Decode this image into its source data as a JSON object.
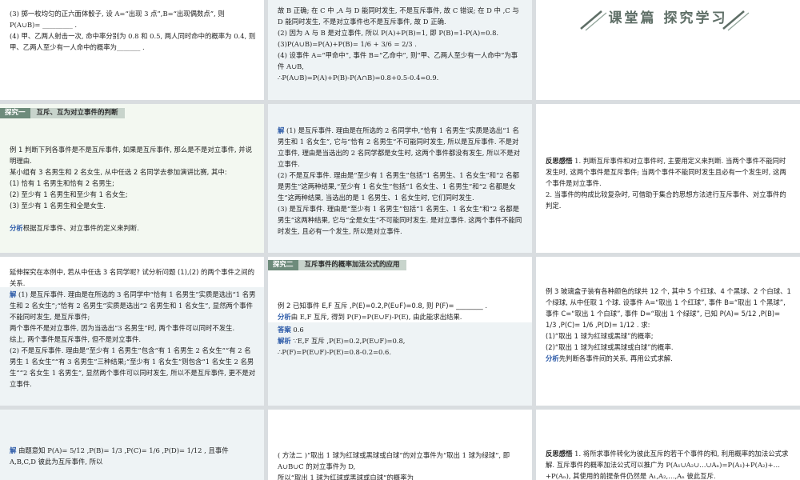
{
  "tiles": {
    "t1": {
      "text": "(3) 掷一枚均匀的正六面体骰子, 设 A=“出现 3 点”,B=“出现偶数点”, 则 P(A∪B)= _________ .\n(4) 甲、乙两人射击一次, 命中率分别为 0.8 和 0.5, 两人同时命中的概率为 0.4, 则甲、乙两人至少有一人命中的概率为_______ ."
    },
    "t2": {
      "text": "故 B 正确; 在 C 中 ,A 与 D 能同时发生, 不是互斥事件, 故 C 错误; 在 D 中 ,C 与 D 能同时发生, 不是对立事件也不是互斥事件, 故 D 正确.\n(2) 因为 A 与 B 是对立事件, 所以 P(A)+P(B)=1, 即 P(B)=1-P(A)=0.8.\n(3)P(A∪B)=P(A)+P(B)= 1/6 + 3/6 = 2/3 .\n(4) 设事件 A=“甲命中”, 事件 B=“乙命中”, 则“甲、乙两人至少有一人命中”为事件 A∪B,\n∴P(A∪B)=P(A)+P(B)-P(A∩B)=0.8+0.5-0.4=0.9."
    },
    "t3": {
      "banner": "课堂篇 探究学习"
    },
    "t4": {
      "tab_num": "探究一",
      "tab_title": "互斥、互为对立事件的判断",
      "example": "例 1 判断下列各事件是不是互斥事件, 如果是互斥事件, 那么是不是对立事件, 并说明理由.\n某小组有 3 名男生和 2 名女生, 从中任选 2 名同学去参加演讲比赛, 其中:\n(1) 恰有 1 名男生和恰有 2 名男生;\n(2) 至少有 1 名男生和至少有 1 名女生;\n(3) 至少有 1 名男生和全是女生.",
      "analysis_label": "分析",
      "analysis": "根据互斥事件、对立事件的定义来判断."
    },
    "t5": {
      "label": "解",
      "text": " (1) 是互斥事件. 理由是在所选的 2 名同学中,“恰有 1 名男生”实质是选出“1 名男生和 1 名女生”, 它与“恰有 2 名男生”不可能同时发生, 所以是互斥事件. 不是对立事件, 理由是当选出的 2 名同学都是女生时, 这两个事件都没有发生, 所以不是对立事件.\n(2) 不是互斥事件. 理由是“至少有 1 名男生”包括“1 名男生、1 名女生”和“2 名都是男生”这两种结果,“至少有 1 名女生”包括“1 名女生、1 名男生”和“2 名都是女生”这两种结果, 当选出的是 1 名男生、1 名女生时, 它们同时发生.\n(3) 是互斥事件. 理由是“至少有 1 名男生”包括“1 名男生、1 名女生”和“2 名都是男生”这两种结果, 它与“全是女生”不可能同时发生. 是对立事件. 这两个事件不能同时发生, 且必有一个发生, 所以是对立事件."
    },
    "t6": {
      "label": "反思感悟",
      "text": " 1. 判断互斥事件和对立事件时, 主要用定义来判断. 当两个事件不能同时发生时, 这两个事件是互斥事件; 当两个事件不能同时发生且必有一个发生时, 这两个事件是对立事件.\n2. 当事件的构成比较复杂时, 可借助于集合的思想方法进行互斥事件、对立事件的判定."
    },
    "t7": {
      "question": "延伸探究在本例中, 若从中任选 3 名同学呢? 试分析问题 (1),(2) 的两个事件之间的关系.",
      "label": "解",
      "text": " (1) 是互斥事件. 理由是在所选的 3 名同学中“恰有 1 名男生”实质是选出“1 名男生和 2 名女生”;“恰有 2 名男生”实质是选出“2 名男生和 1 名女生”, 显然两个事件不能同时发生, 是互斥事件;\n两个事件不是对立事件, 因为当选出“3 名男生”时, 两个事件可以同时不发生.\n综上, 两个事件是互斥事件, 但不是对立事件.\n(2) 不是互斥事件. 理由是“至少有 1 名男生”包含“有 1 名男生 2 名女生”“有 2 名男生 1 名女生”“有 3 名男生”三种结果;“至少有 1 名女生”则包含“1 名女生 2 名男生”“2 名女生 1 名男生”, 显然两个事件可以同时发生, 所以不是互斥事件, 更不是对立事件."
    },
    "t8": {
      "tab_num": "探究二",
      "tab_title": "互斥事件的概率加法公式的应用",
      "example": "例 2 已知事件 E,F 互斥 ,P(E)=0.2,P(E∪F)=0.8, 则 P(F)= ________ .",
      "analysis_label": "分析",
      "analysis": "由 E,F 互斥, 得到 P(F)=P(E∪F)-P(E), 由此能求出结果.",
      "answer_label": "答案",
      "answer": " 0.6",
      "solution_label": "解析",
      "solution": " ∵E,F 互斥 ,P(E)=0.2,P(E∪F)=0.8,\n∴P(F)=P(E∪F)-P(E)=0.8-0.2=0.6."
    },
    "t9": {
      "example": "例 3 玻璃盒子装有各种颜色的球共 12 个, 其中 5 个红球、4 个黑球、2 个白球、1 个绿球, 从中任取 1 个球. 设事件 A=“取出 1 个红球”, 事件 B=“取出 1 个黑球”, 事件 C=“取出 1 个白球”, 事件 D=“取出 1 个绿球”, 已知 P(A)= 5/12 ,P(B)= 1/3 ,P(C)= 1/6 ,P(D)= 1/12 . 求:",
      "q1": "(1)“取出 1 球为红球或黑球”的概率;",
      "q2": "(2)“取出 1 球为红球或黑球或白球”的概率.",
      "analysis_label": "分析",
      "analysis": "先判断各事件间的关系, 再用公式求解."
    },
    "t10": {
      "label": "解",
      "text": " 由题意知 P(A)= 5/12 ,P(B)= 1/3 ,P(C)= 1/6 ,P(D)= 1/12 , 且事件 A,B,C,D 彼此为互斥事件, 所以"
    },
    "t11": {
      "text": "( 方法二 )“取出 1 球为红球或黑球或白球”的对立事件为“取出 1 球为绿球”, 即 A∪B∪C 的对立事件为 D,\n所以“取出 1 球为红球或黑球或白球”的概率为"
    },
    "t12": {
      "label": "反思感悟",
      "text": " 1. 将所求事件转化为彼此互斥的若干个事件的和, 利用概率的加法公式求解. 互斥事件的概率加法公式可以推广为 P(A₁∪A₂∪…∪Aₙ)=P(A₁)+P(A₂)+…+P(Aₙ), 其使用的前提条件仍然是 A₁,A₂,…,Aₙ 彼此互斥."
    }
  }
}
